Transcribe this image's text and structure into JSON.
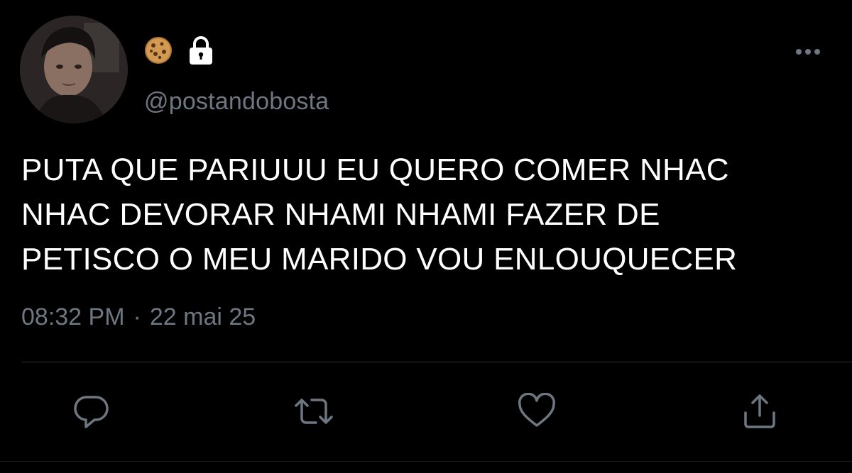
{
  "tweet": {
    "author": {
      "display_name_icons": [
        "cookie-icon",
        "lock-icon"
      ],
      "handle": "@postandobosta"
    },
    "text": "PUTA QUE PARIUUU EU QUERO COMER NHAC\nNHAC DEVORAR NHAMI NHAMI FAZER DE\nPETISCO O MEU MARIDO VOU ENLOUQUECER",
    "time": "08:32 PM",
    "separator": "·",
    "date": "22 mai 25",
    "actions": [
      "reply-icon",
      "retweet-icon",
      "like-icon",
      "share-icon"
    ]
  },
  "theme": {
    "background": "#000000",
    "text": "#ffffff",
    "muted": "#6e7781",
    "divider": "#2a2f35"
  }
}
